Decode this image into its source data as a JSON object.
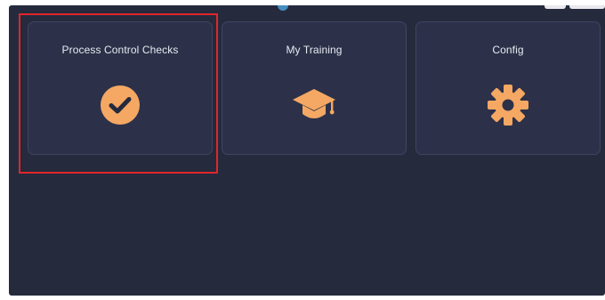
{
  "tiles": [
    {
      "label": "Process Control Checks",
      "icon": "check-circle-icon"
    },
    {
      "label": "My Training",
      "icon": "graduation-cap-icon"
    },
    {
      "label": "Config",
      "icon": "gear-icon"
    }
  ],
  "colors": {
    "background": "#252a3d",
    "tile": "#2c3149",
    "tile_border": "#3e4560",
    "accent": "#f5a863",
    "highlight": "#e0262a",
    "text": "#e8eaf2"
  }
}
